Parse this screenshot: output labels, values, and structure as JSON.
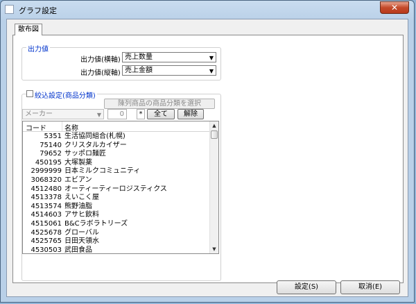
{
  "window": {
    "title": "グラフ設定"
  },
  "tab": {
    "label": "散布図"
  },
  "output_group": {
    "title": "出力値",
    "x_label": "出力値(横軸)",
    "x_value": "売上数量",
    "y_label": "出力値(縦軸)",
    "y_value": "売上金額"
  },
  "filter_group": {
    "title": "絞込設定(商品分類)",
    "select_category_button": "陳列商品の商品分類を選択",
    "maker_combo": "メーカー",
    "count_value": "0",
    "star_label": "*",
    "all_button": "全て",
    "clear_button": "解除",
    "columns": [
      "コード",
      "名称"
    ],
    "rows": [
      {
        "code": "5351",
        "name": "生活協同組合(札幌)"
      },
      {
        "code": "75140",
        "name": "クリスタルカイザー"
      },
      {
        "code": "79652",
        "name": "サッポロ麺匠"
      },
      {
        "code": "450195",
        "name": "大塚製薬"
      },
      {
        "code": "2999999",
        "name": "日本ミルクコミュニティ"
      },
      {
        "code": "3068320",
        "name": "エビアン"
      },
      {
        "code": "4512480",
        "name": "オーティーティーロジスティクス"
      },
      {
        "code": "4513378",
        "name": "えいこく屋"
      },
      {
        "code": "4513574",
        "name": "熊野油脂"
      },
      {
        "code": "4514603",
        "name": "アサヒ飲料"
      },
      {
        "code": "4515061",
        "name": "B&Cラボラトリーズ"
      },
      {
        "code": "4525678",
        "name": "グローバル"
      },
      {
        "code": "4525765",
        "name": "日田天領水"
      },
      {
        "code": "4530503",
        "name": "武田食品"
      }
    ]
  },
  "buttons": {
    "ok": "設定(S)",
    "cancel": "取消(E)"
  },
  "icons": {
    "close": "close-icon",
    "dropdown": "chevron-down-icon"
  }
}
